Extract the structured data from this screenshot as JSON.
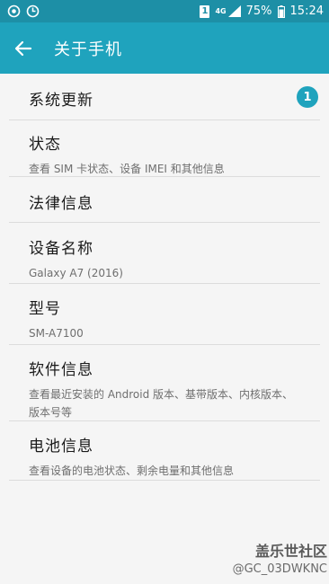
{
  "status_bar": {
    "sim_slot": "1",
    "network": "4G",
    "battery_percent": "75%",
    "time": "15:24",
    "left_icons": [
      "circle-b-icon",
      "circle-d-icon"
    ]
  },
  "app_bar": {
    "title": "关于手机",
    "back_icon": "arrow-left-icon"
  },
  "items": [
    {
      "title": "系统更新",
      "subtitle": "",
      "badge": "1"
    },
    {
      "title": "状态",
      "subtitle": "查看 SIM 卡状态、设备 IMEI 和其他信息"
    },
    {
      "title": "法律信息",
      "subtitle": ""
    },
    {
      "title": "设备名称",
      "subtitle": "Galaxy A7 (2016)"
    },
    {
      "title": "型号",
      "subtitle": "SM-A7100"
    },
    {
      "title": "软件信息",
      "subtitle": "查看最近安装的 Android 版本、基带版本、内核版本、版本号等"
    },
    {
      "title": "电池信息",
      "subtitle": "查看设备的电池状态、剩余电量和其他信息"
    }
  ],
  "watermark": {
    "line1": "盖乐世社区",
    "line2": "@GC_03DWKNC"
  },
  "colors": {
    "status_bar": "#1d8fa6",
    "app_bar": "#1fa3bd",
    "background": "#f5f5f5",
    "badge": "#1fa3bd"
  }
}
